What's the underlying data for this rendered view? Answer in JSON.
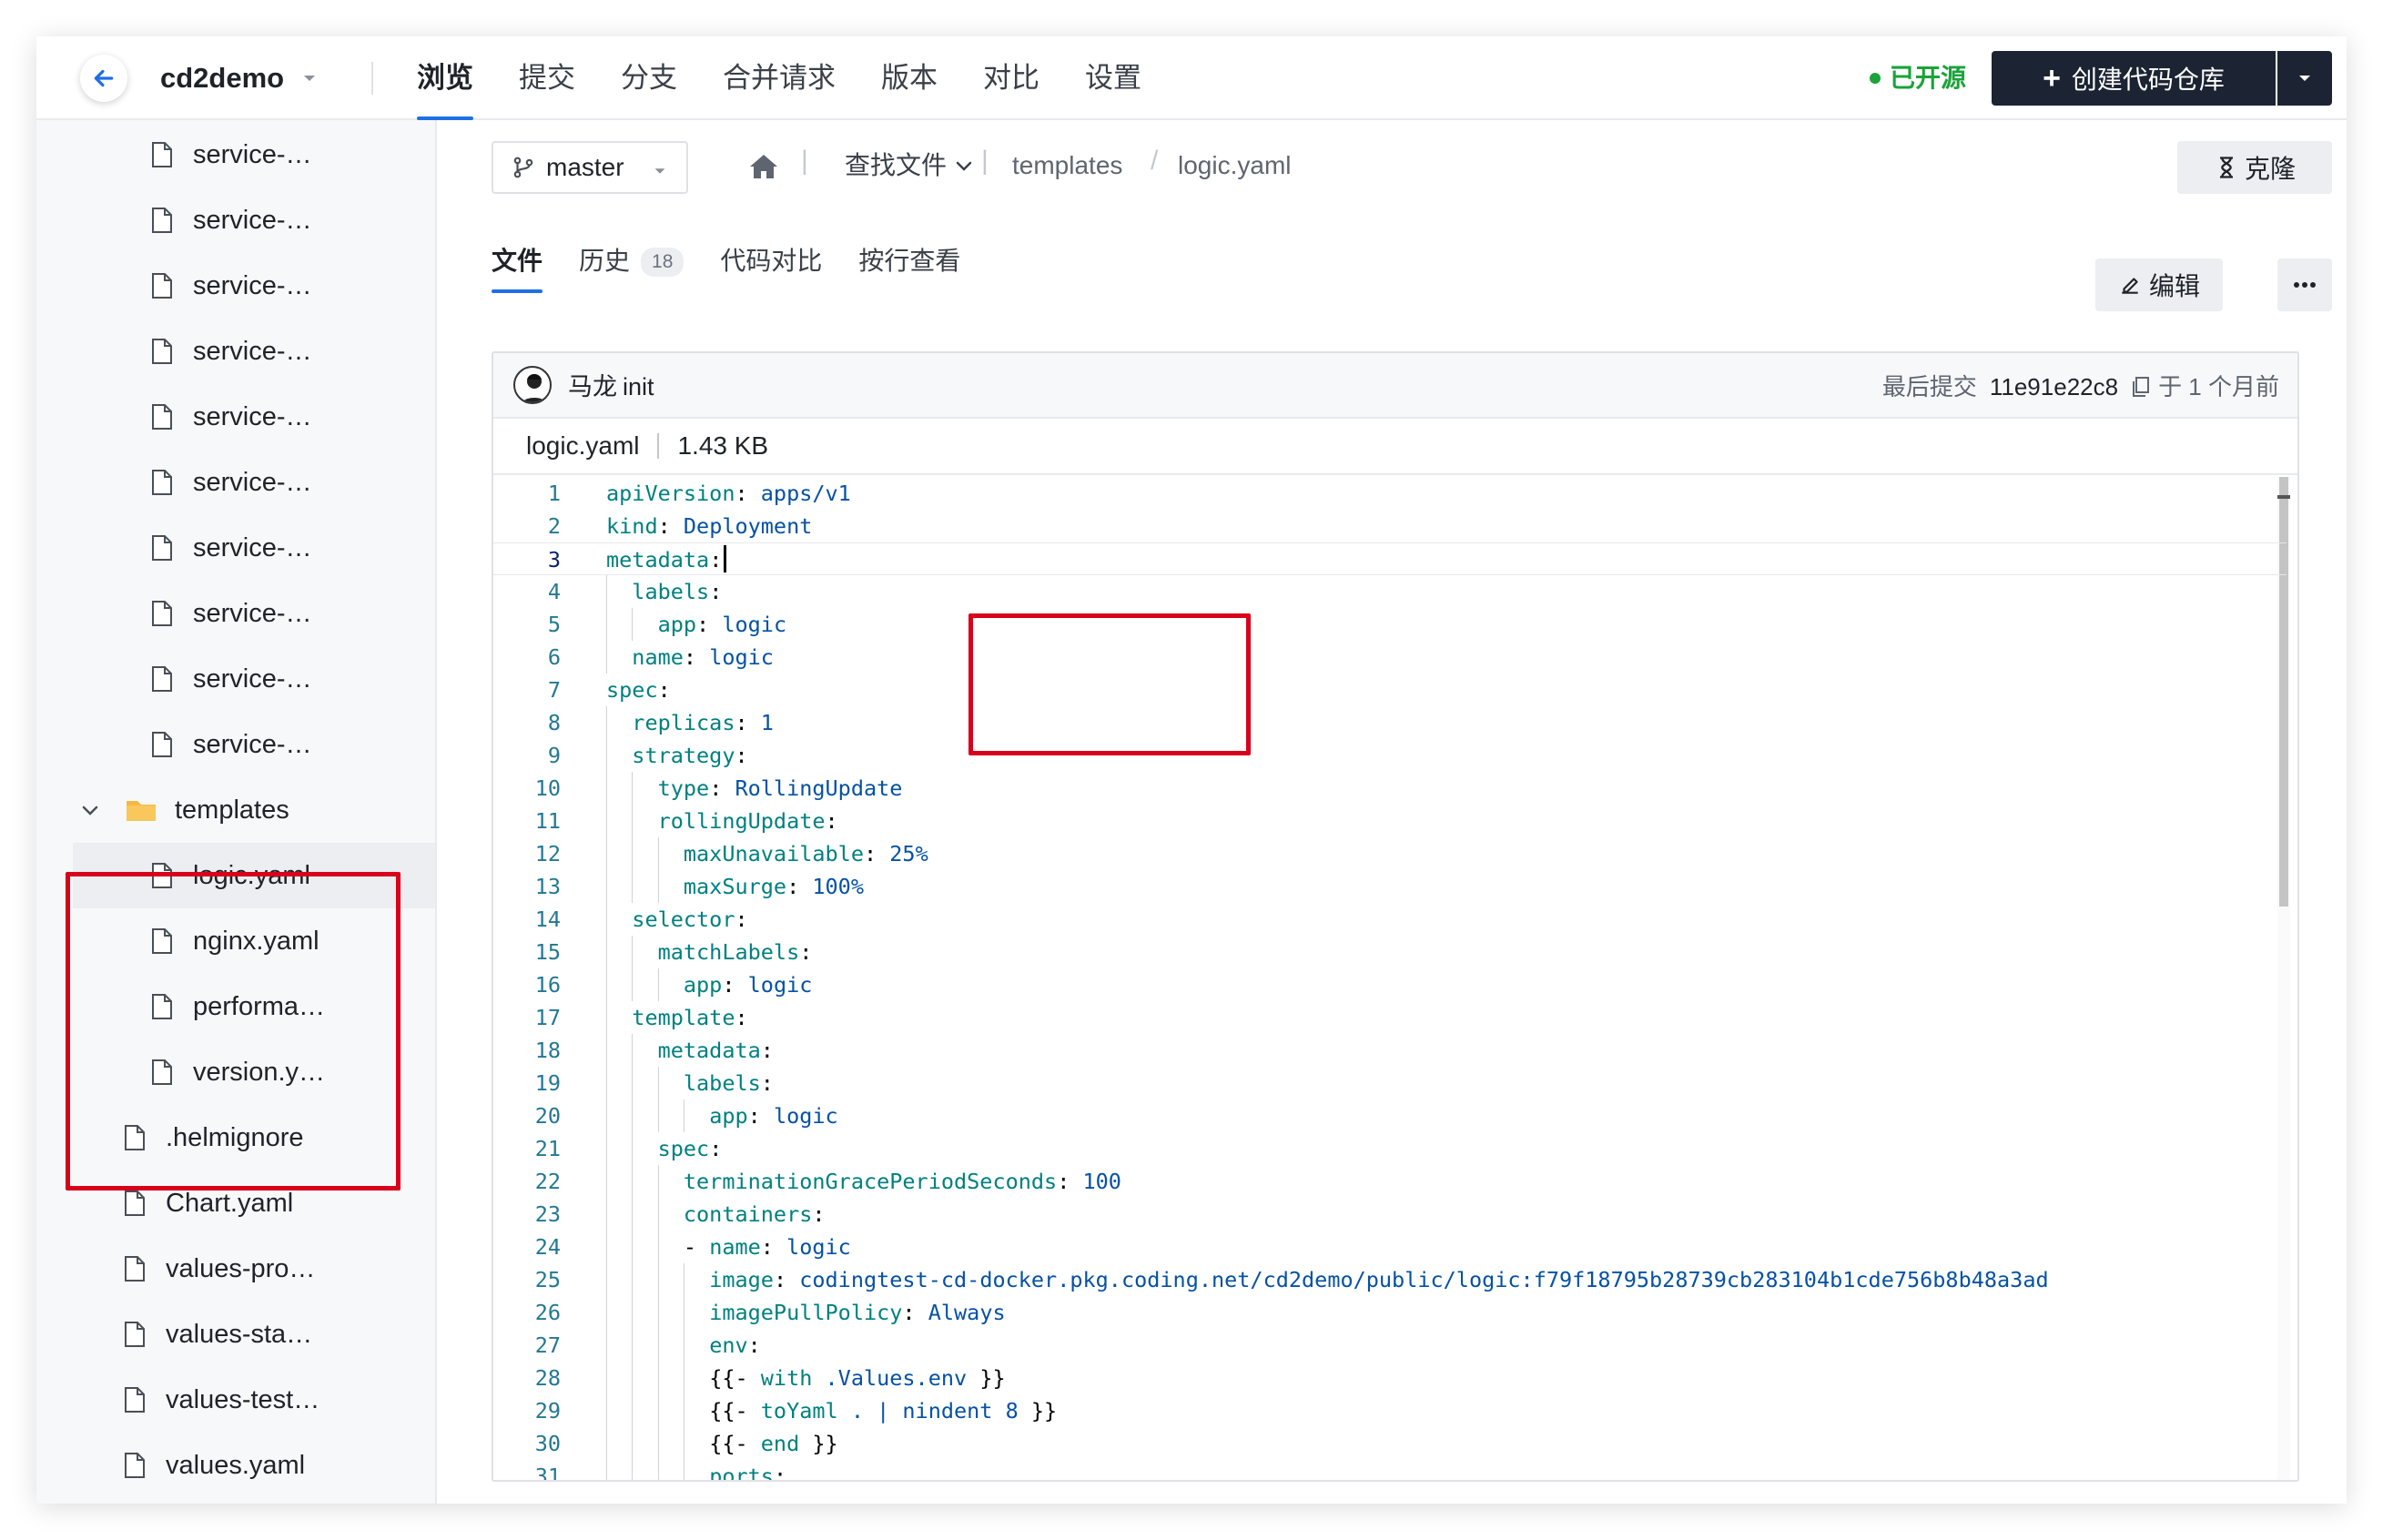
{
  "header": {
    "project_name": "cd2demo",
    "tabs": [
      {
        "label": "浏览",
        "active": true
      },
      {
        "label": "提交"
      },
      {
        "label": "分支"
      },
      {
        "label": "合并请求"
      },
      {
        "label": "版本"
      },
      {
        "label": "对比"
      },
      {
        "label": "设置"
      }
    ],
    "open_source_label": "已开源",
    "create_button_label": "创建代码仓库",
    "accent_color": "#1f6fe5",
    "open_source_color": "#1aa33a"
  },
  "sidebar": {
    "items": [
      {
        "label": "service-…"
      },
      {
        "label": "service-…"
      },
      {
        "label": "service-…"
      },
      {
        "label": "service-…"
      },
      {
        "label": "service-…"
      },
      {
        "label": "service-…"
      },
      {
        "label": "service-…"
      },
      {
        "label": "service-…"
      },
      {
        "label": "service-…"
      },
      {
        "label": "service-…"
      },
      {
        "label": "templates",
        "type": "folder",
        "expanded": true
      },
      {
        "label": "logic.yaml",
        "selected": true
      },
      {
        "label": "nginx.yaml"
      },
      {
        "label": "performa…"
      },
      {
        "label": "version.y…"
      },
      {
        "label": ".helmignore"
      },
      {
        "label": "Chart.yaml"
      },
      {
        "label": "values-pro…"
      },
      {
        "label": "values-sta…"
      },
      {
        "label": "values-test…"
      },
      {
        "label": "values.yaml"
      }
    ]
  },
  "toolbar": {
    "branch": "master",
    "find_file_label": "查找文件",
    "breadcrumb": [
      "templates",
      "logic.yaml"
    ],
    "clone_label": "克隆",
    "edit_label": "编辑"
  },
  "subtabs": {
    "file": "文件",
    "history": "历史",
    "history_count": "18",
    "diff": "代码对比",
    "blame": "按行查看"
  },
  "commit": {
    "author": "马龙",
    "message": "init",
    "last_commit_label": "最后提交",
    "hash": "11e91e22c8",
    "time": "于 1 个月前"
  },
  "file": {
    "name": "logic.yaml",
    "size": "1.43 KB",
    "current_line": 3,
    "lines": [
      "apiVersion: apps/v1",
      "kind: Deployment",
      "metadata:",
      "  labels:",
      "    app: logic",
      "  name: logic",
      "spec:",
      "  replicas: 1",
      "  strategy:",
      "    type: RollingUpdate",
      "    rollingUpdate:",
      "      maxUnavailable: 25%",
      "      maxSurge: 100%",
      "  selector:",
      "    matchLabels:",
      "      app: logic",
      "  template:",
      "    metadata:",
      "      labels:",
      "        app: logic",
      "    spec:",
      "      terminationGracePeriodSeconds: 100",
      "      containers:",
      "      - name: logic",
      "        image: codingtest-cd-docker.pkg.coding.net/cd2demo/public/logic:f79f18795b28739cb283104b1cde756b8b48a3ad",
      "        imagePullPolicy: Always",
      "        env:",
      "        {{- with .Values.env }}",
      "        {{- toYaml . | nindent 8 }}",
      "        {{- end }}",
      "        ports:"
    ]
  }
}
